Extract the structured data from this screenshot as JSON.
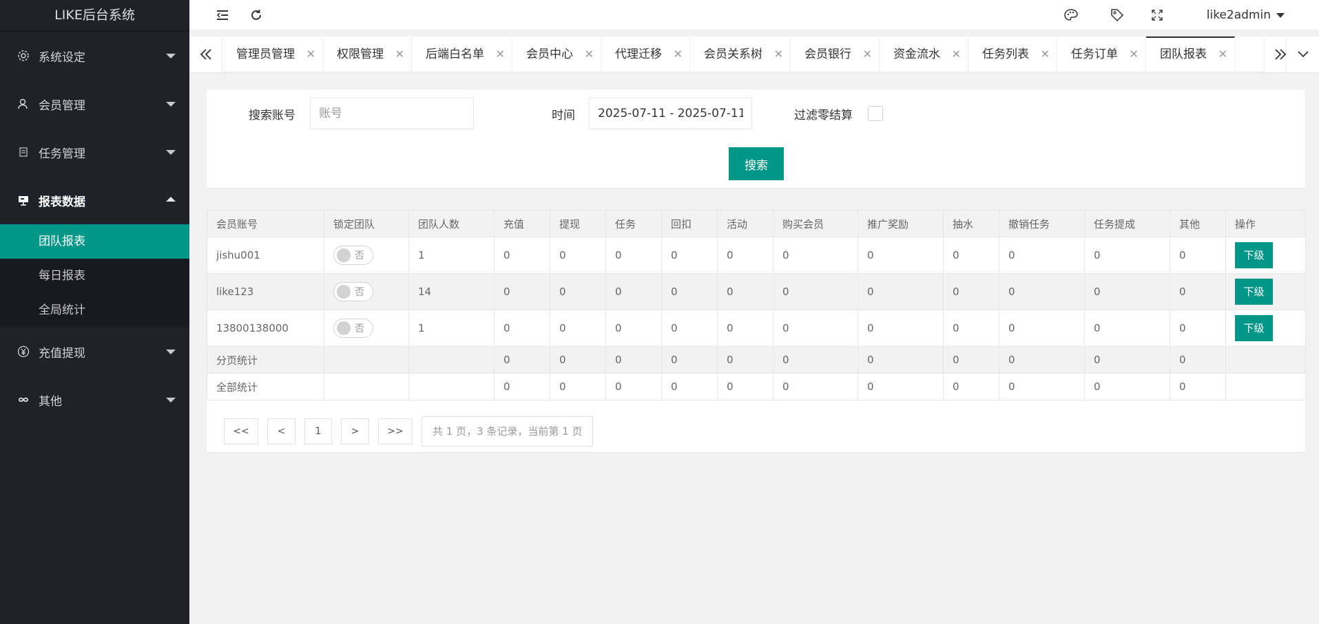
{
  "app": {
    "title": "LIKE后台系统"
  },
  "sidebar": {
    "items": [
      {
        "label": "系统设定",
        "icon": "gear-icon"
      },
      {
        "label": "会员管理",
        "icon": "user-icon"
      },
      {
        "label": "任务管理",
        "icon": "document-icon"
      },
      {
        "label": "报表数据",
        "icon": "board-icon"
      },
      {
        "label": "充值提现",
        "icon": "yen-icon"
      },
      {
        "label": "其他",
        "icon": "infinity-icon"
      }
    ],
    "subitems": [
      {
        "label": "团队报表"
      },
      {
        "label": "每日报表"
      },
      {
        "label": "全局统计"
      }
    ]
  },
  "header": {
    "user": "like2admin"
  },
  "tabs": [
    {
      "label": "管理员管理"
    },
    {
      "label": "权限管理"
    },
    {
      "label": "后端白名单"
    },
    {
      "label": "会员中心"
    },
    {
      "label": "代理迁移"
    },
    {
      "label": "会员关系树"
    },
    {
      "label": "会员银行"
    },
    {
      "label": "资金流水"
    },
    {
      "label": "任务列表"
    },
    {
      "label": "任务订单"
    },
    {
      "label": "团队报表"
    }
  ],
  "search": {
    "account_label": "搜索账号",
    "account_placeholder": "账号",
    "account_value": "",
    "time_label": "时间",
    "time_value": "2025-07-11 - 2025-07-11",
    "filter_label": "过滤零结算",
    "button_label": "搜索"
  },
  "table": {
    "columns": [
      "会员账号",
      "锁定团队",
      "团队人数",
      "充值",
      "提现",
      "任务",
      "回扣",
      "活动",
      "购买会员",
      "推广奖励",
      "抽水",
      "撤销任务",
      "任务提成",
      "其他",
      "操作"
    ],
    "rows": [
      {
        "account": "jishu001",
        "lock": "否",
        "members": "1",
        "vals": [
          "0",
          "0",
          "0",
          "0",
          "0",
          "0",
          "0",
          "0",
          "0",
          "0",
          "0"
        ],
        "action": "下级"
      },
      {
        "account": "like123",
        "lock": "否",
        "members": "14",
        "vals": [
          "0",
          "0",
          "0",
          "0",
          "0",
          "0",
          "0",
          "0",
          "0",
          "0",
          "0"
        ],
        "action": "下级"
      },
      {
        "account": "13800138000",
        "lock": "否",
        "members": "1",
        "vals": [
          "0",
          "0",
          "0",
          "0",
          "0",
          "0",
          "0",
          "0",
          "0",
          "0",
          "0"
        ],
        "action": "下级"
      }
    ],
    "summary": [
      {
        "label": "分页统计",
        "vals": [
          "0",
          "0",
          "0",
          "0",
          "0",
          "0",
          "0",
          "0",
          "0",
          "0",
          "0"
        ]
      },
      {
        "label": "全部统计",
        "vals": [
          "0",
          "0",
          "0",
          "0",
          "0",
          "0",
          "0",
          "0",
          "0",
          "0",
          "0"
        ]
      }
    ]
  },
  "pagination": {
    "first": "<<",
    "prev": "<",
    "page": "1",
    "next": ">",
    "last": ">>",
    "info": "共 1 页，3 条记录，当前第 1 页"
  },
  "colors": {
    "accent": "#009688",
    "sidebar_bg": "#20222a"
  }
}
